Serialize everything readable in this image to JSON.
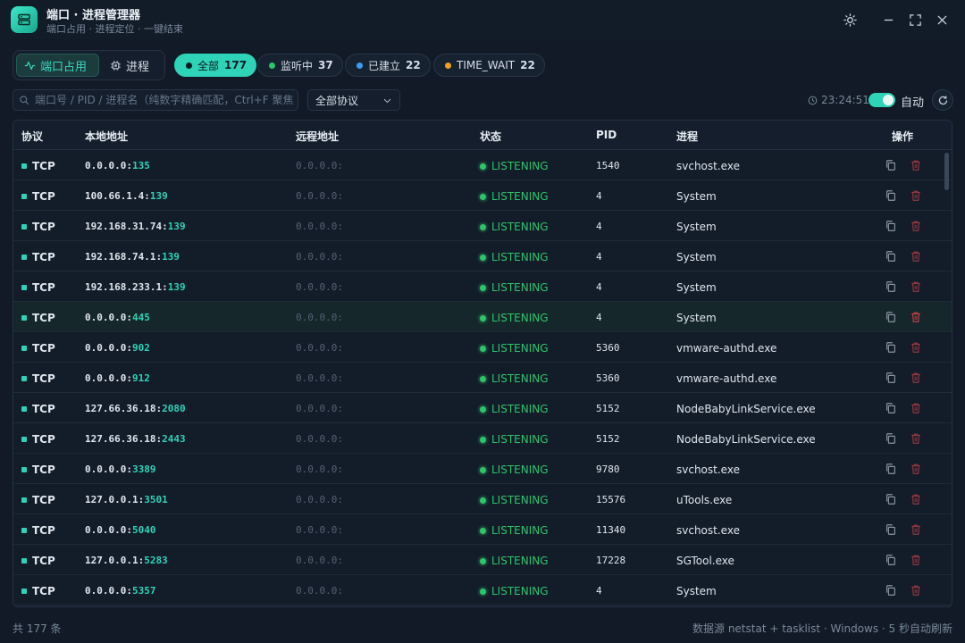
{
  "app": {
    "title": "端口 · 进程管理器",
    "subtitle": "端口占用 · 进程定位 · 一键结束"
  },
  "mode_tabs": [
    {
      "label": "端口占用",
      "active": true,
      "icon": "activity-icon"
    },
    {
      "label": "进程",
      "active": false,
      "icon": "chip-icon"
    }
  ],
  "filters": [
    {
      "label": "全部",
      "count": "177",
      "color": "#0e1a22",
      "active": true
    },
    {
      "label": "监听中",
      "count": "37",
      "color": "#2ec46b",
      "active": false
    },
    {
      "label": "已建立",
      "count": "22",
      "color": "#3b9cf0",
      "active": false
    },
    {
      "label": "TIME_WAIT",
      "count": "22",
      "color": "#f0a020",
      "active": false
    }
  ],
  "search": {
    "placeholder": "端口号 / PID / 进程名（纯数字精确匹配，Ctrl+F 聚焦）",
    "value": ""
  },
  "protocol_select": {
    "value": "全部协议"
  },
  "clock": {
    "time": "23:24:51"
  },
  "auto_refresh": {
    "label": "自动",
    "enabled": true
  },
  "table": {
    "headers": {
      "protocol": "协议",
      "local": "本地地址",
      "remote": "远程地址",
      "state": "状态",
      "pid": "PID",
      "process": "进程",
      "actions": "操作"
    },
    "rows": [
      {
        "proto": "TCP",
        "local_ip": "0.0.0.0:",
        "local_port": "135",
        "remote": "0.0.0.0:",
        "state": "LISTENING",
        "pid": "1540",
        "process": "svchost.exe",
        "highlight": false
      },
      {
        "proto": "TCP",
        "local_ip": "100.66.1.4:",
        "local_port": "139",
        "remote": "0.0.0.0:",
        "state": "LISTENING",
        "pid": "4",
        "process": "System",
        "highlight": false
      },
      {
        "proto": "TCP",
        "local_ip": "192.168.31.74:",
        "local_port": "139",
        "remote": "0.0.0.0:",
        "state": "LISTENING",
        "pid": "4",
        "process": "System",
        "highlight": false
      },
      {
        "proto": "TCP",
        "local_ip": "192.168.74.1:",
        "local_port": "139",
        "remote": "0.0.0.0:",
        "state": "LISTENING",
        "pid": "4",
        "process": "System",
        "highlight": false
      },
      {
        "proto": "TCP",
        "local_ip": "192.168.233.1:",
        "local_port": "139",
        "remote": "0.0.0.0:",
        "state": "LISTENING",
        "pid": "4",
        "process": "System",
        "highlight": false
      },
      {
        "proto": "TCP",
        "local_ip": "0.0.0.0:",
        "local_port": "445",
        "remote": "0.0.0.0:",
        "state": "LISTENING",
        "pid": "4",
        "process": "System",
        "highlight": true
      },
      {
        "proto": "TCP",
        "local_ip": "0.0.0.0:",
        "local_port": "902",
        "remote": "0.0.0.0:",
        "state": "LISTENING",
        "pid": "5360",
        "process": "vmware-authd.exe",
        "highlight": false
      },
      {
        "proto": "TCP",
        "local_ip": "0.0.0.0:",
        "local_port": "912",
        "remote": "0.0.0.0:",
        "state": "LISTENING",
        "pid": "5360",
        "process": "vmware-authd.exe",
        "highlight": false
      },
      {
        "proto": "TCP",
        "local_ip": "127.66.36.18:",
        "local_port": "2080",
        "remote": "0.0.0.0:",
        "state": "LISTENING",
        "pid": "5152",
        "process": "NodeBabyLinkService.exe",
        "highlight": false
      },
      {
        "proto": "TCP",
        "local_ip": "127.66.36.18:",
        "local_port": "2443",
        "remote": "0.0.0.0:",
        "state": "LISTENING",
        "pid": "5152",
        "process": "NodeBabyLinkService.exe",
        "highlight": false
      },
      {
        "proto": "TCP",
        "local_ip": "0.0.0.0:",
        "local_port": "3389",
        "remote": "0.0.0.0:",
        "state": "LISTENING",
        "pid": "9780",
        "process": "svchost.exe",
        "highlight": false
      },
      {
        "proto": "TCP",
        "local_ip": "127.0.0.1:",
        "local_port": "3501",
        "remote": "0.0.0.0:",
        "state": "LISTENING",
        "pid": "15576",
        "process": "uTools.exe",
        "highlight": false
      },
      {
        "proto": "TCP",
        "local_ip": "0.0.0.0:",
        "local_port": "5040",
        "remote": "0.0.0.0:",
        "state": "LISTENING",
        "pid": "11340",
        "process": "svchost.exe",
        "highlight": false
      },
      {
        "proto": "TCP",
        "local_ip": "127.0.0.1:",
        "local_port": "5283",
        "remote": "0.0.0.0:",
        "state": "LISTENING",
        "pid": "17228",
        "process": "SGTool.exe",
        "highlight": false
      },
      {
        "proto": "TCP",
        "local_ip": "0.0.0.0:",
        "local_port": "5357",
        "remote": "0.0.0.0:",
        "state": "LISTENING",
        "pid": "4",
        "process": "System",
        "highlight": false
      }
    ]
  },
  "footer": {
    "total": "共 177 条",
    "source": "数据源 netstat + tasklist · Windows · 5 秒自动刷新"
  },
  "colors": {
    "accent": "#2fd3b7",
    "listening": "#2ec46b",
    "danger": "#c0404a"
  }
}
